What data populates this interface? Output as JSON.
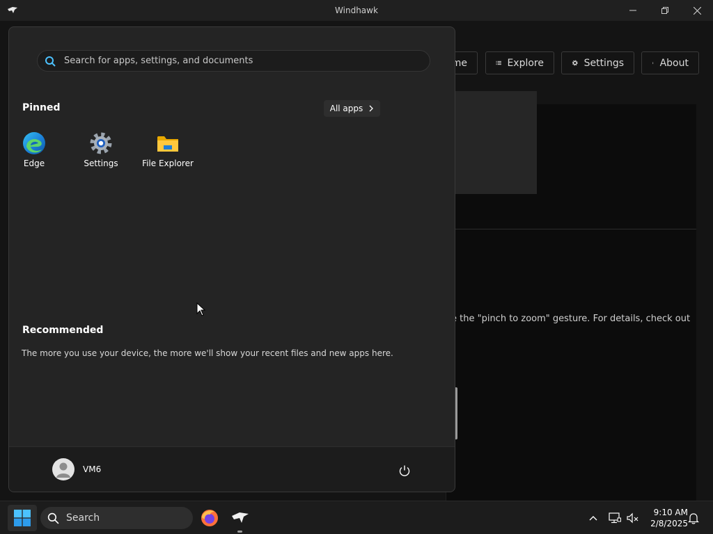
{
  "window": {
    "title": "Windhawk",
    "minimize_icon": "minimize-icon",
    "restore_icon": "restore-icon",
    "close_icon": "close-icon"
  },
  "app": {
    "nav": {
      "home_label": "me",
      "explore_label": "Explore",
      "settings_label": "Settings",
      "about_label": "About"
    },
    "body_text": "e the \"pinch to zoom\" gesture. For details, check out"
  },
  "start_menu": {
    "search_placeholder": "Search for apps, settings, and documents",
    "pinned_title": "Pinned",
    "all_apps_label": "All apps",
    "pinned_apps": [
      {
        "label": "Edge",
        "icon": "edge-icon"
      },
      {
        "label": "Settings",
        "icon": "settings-gear-icon"
      },
      {
        "label": "File Explorer",
        "icon": "folder-icon"
      }
    ],
    "recommended_title": "Recommended",
    "recommended_text": "The more you use your device, the more we'll show your recent files and new apps here.",
    "user_name": "VM6",
    "power_icon": "power-icon"
  },
  "taskbar": {
    "search_label": "Search",
    "apps": [
      "firefox-icon",
      "windhawk-icon"
    ],
    "tray": [
      "chevron-up-icon",
      "network-icon",
      "volume-muted-icon",
      "bell-icon"
    ],
    "time": "9:10 AM",
    "date": "2/8/2025"
  },
  "colors": {
    "accent": "#0078d4",
    "menu_bg": "#242424",
    "taskbar_bg": "#1c1c1c"
  }
}
